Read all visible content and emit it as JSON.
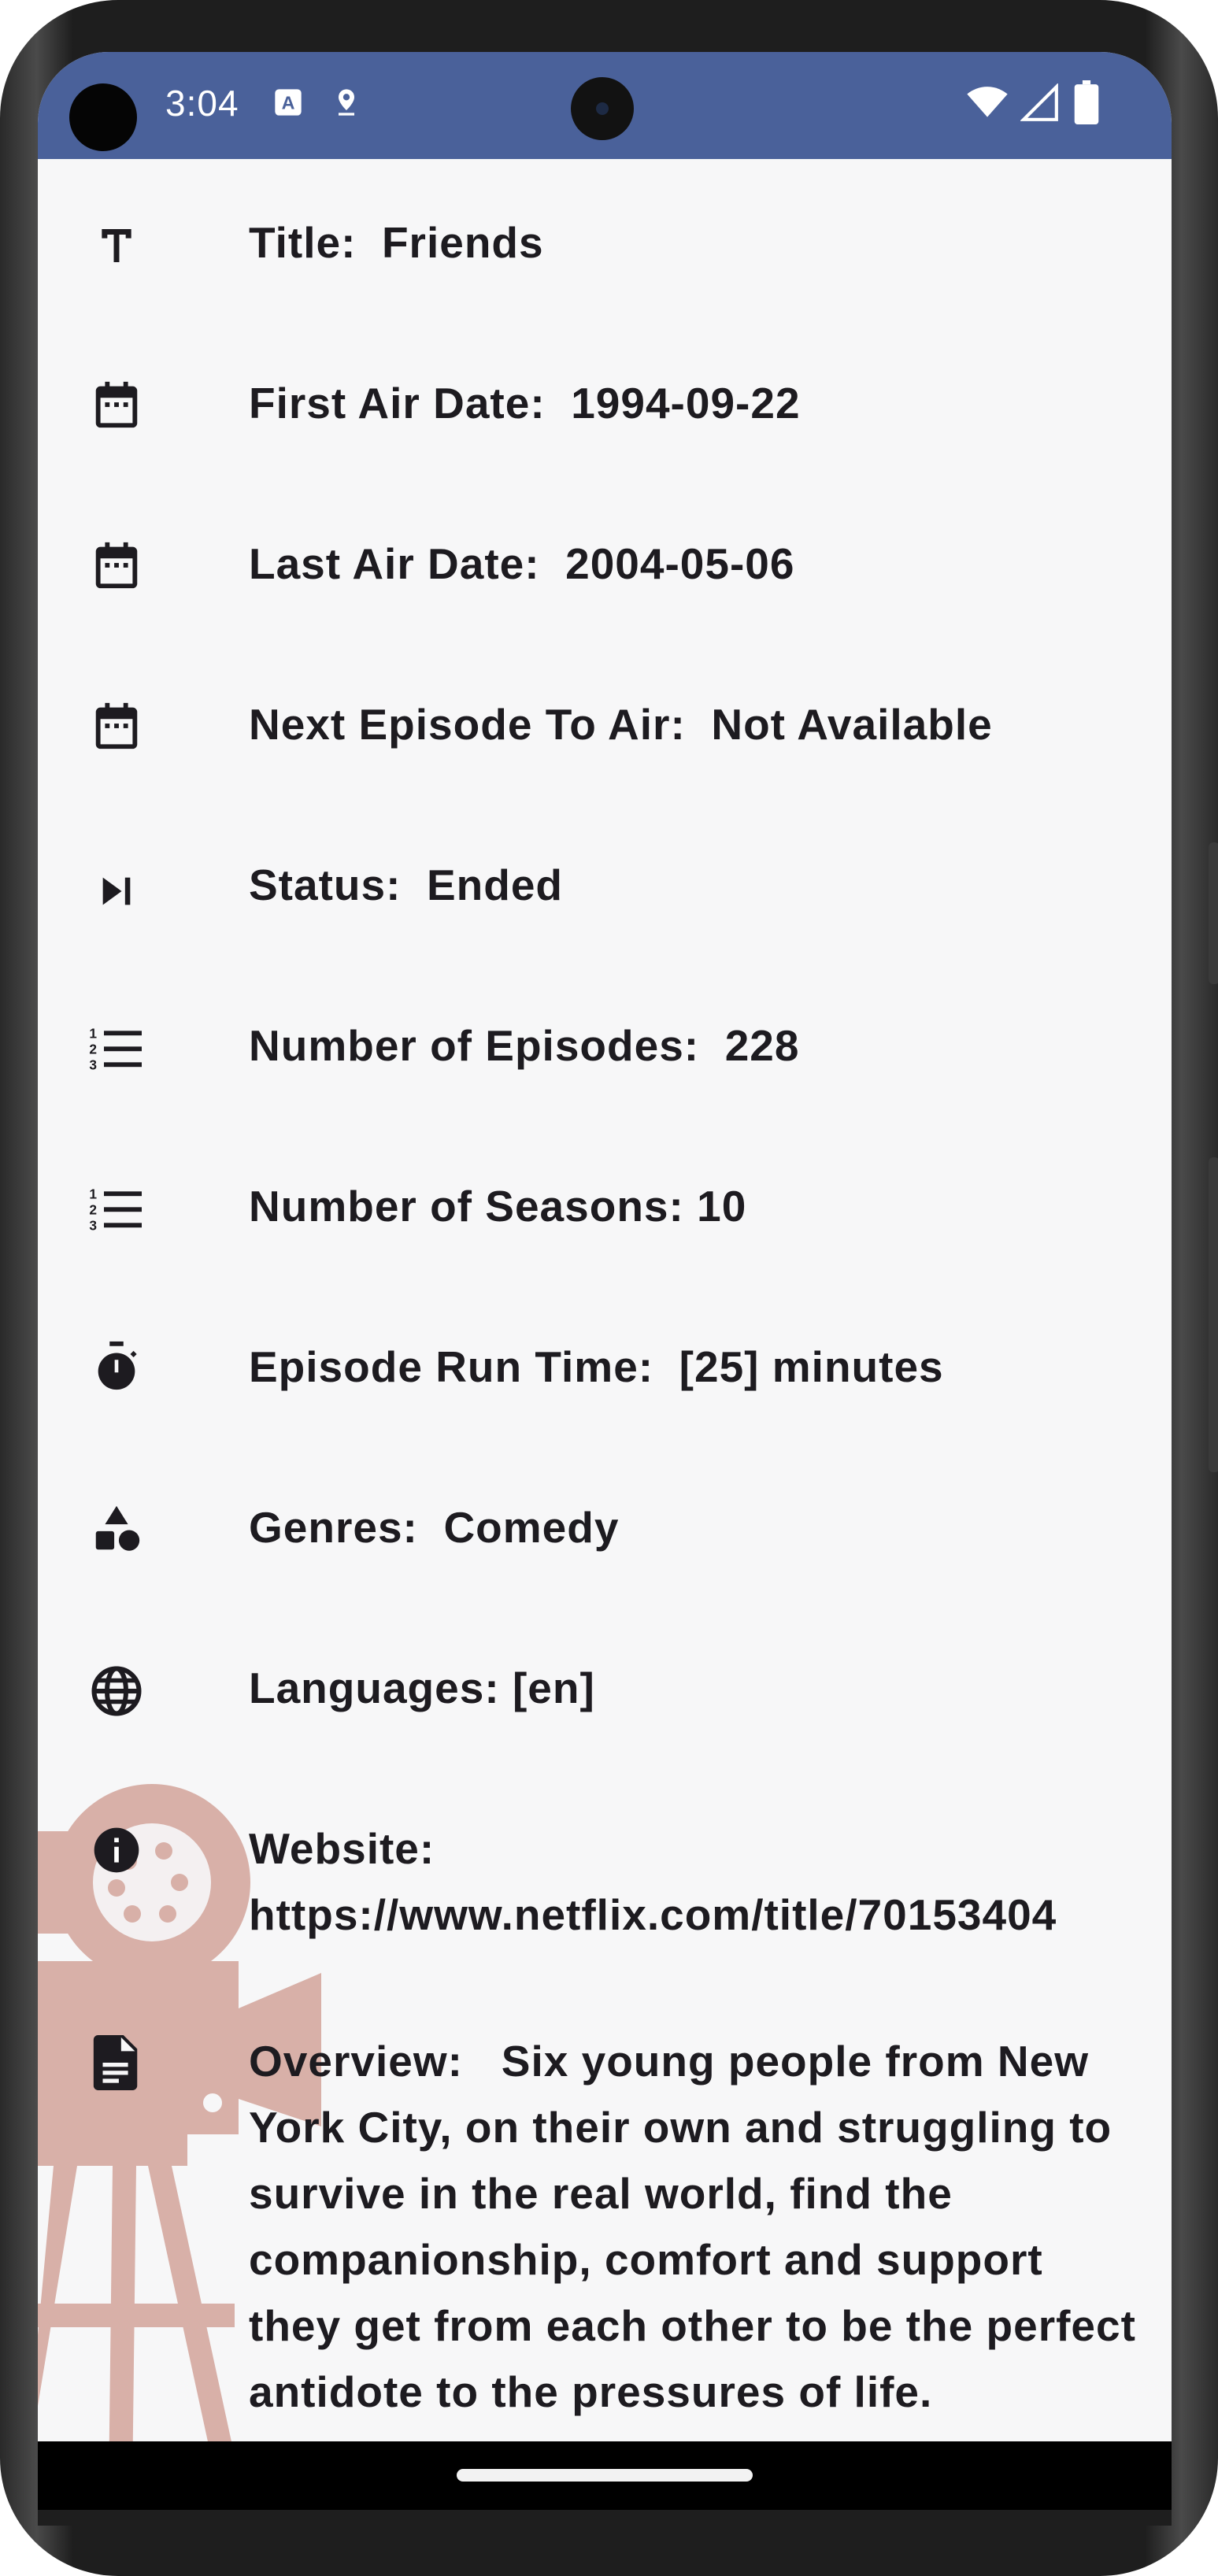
{
  "status_bar": {
    "time": "3:04",
    "bg_color": "#4a619a",
    "icons": [
      "text-a-icon",
      "location-pin-icon",
      "wifi-icon",
      "signal-icon",
      "battery-icon"
    ]
  },
  "details": [
    {
      "icon": "title-t-icon",
      "label": "Title:",
      "value": "Friends"
    },
    {
      "icon": "calendar-icon",
      "label": "First Air Date:",
      "value": "1994-09-22"
    },
    {
      "icon": "calendar-icon",
      "label": "Last Air Date:",
      "value": "2004-05-06"
    },
    {
      "icon": "calendar-icon",
      "label": "Next Episode To Air:",
      "value": "Not Available"
    },
    {
      "icon": "skip-next-icon",
      "label": "Status:",
      "value": "Ended"
    },
    {
      "icon": "numbered-list-icon",
      "label": "Number of Episodes:",
      "value": "228"
    },
    {
      "icon": "numbered-list-icon",
      "label": "Number of Seasons:",
      "value": "10"
    },
    {
      "icon": "timer-icon",
      "label": "Episode Run Time:",
      "value": "[25] minutes"
    },
    {
      "icon": "shapes-icon",
      "label": "Genres:",
      "value": "Comedy"
    },
    {
      "icon": "globe-icon",
      "label": "Languages:",
      "value": "[en]"
    },
    {
      "icon": "info-icon",
      "label": "Website:",
      "value": "https://www.netflix.com/title/70153404"
    },
    {
      "icon": "document-icon",
      "label": "Overview:",
      "value": "Six young people from New York City, on their own and struggling to survive in the real world, find the companionship, comfort and support they get from each other to be the perfect antidote to the pressures of life."
    }
  ]
}
